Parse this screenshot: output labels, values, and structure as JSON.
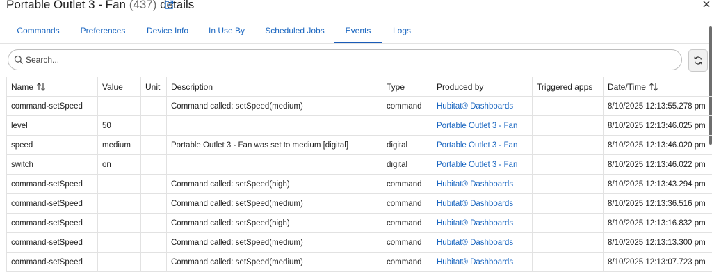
{
  "header": {
    "title": "Portable Outlet 3 - Fan",
    "device_count": "(437)",
    "title_suffix": "details"
  },
  "tabs": [
    {
      "label": "Commands"
    },
    {
      "label": "Preferences"
    },
    {
      "label": "Device Info"
    },
    {
      "label": "In Use By"
    },
    {
      "label": "Scheduled Jobs"
    },
    {
      "label": "Events",
      "active": true
    },
    {
      "label": "Logs"
    }
  ],
  "search": {
    "placeholder": "Search..."
  },
  "table": {
    "columns": [
      "Name",
      "Value",
      "Unit",
      "Description",
      "Type",
      "Produced by",
      "Triggered apps",
      "Date/Time"
    ],
    "rows": [
      [
        "command-setSpeed",
        "",
        "",
        "Command called: setSpeed(medium)",
        "command",
        "Hubitat® Dashboards",
        "",
        "8/10/2025 12:13:55.278 pm"
      ],
      [
        "level",
        "50",
        "",
        "",
        "",
        "Portable Outlet 3 - Fan",
        "",
        "8/10/2025 12:13:46.025 pm"
      ],
      [
        "speed",
        "medium",
        "",
        "Portable Outlet 3 - Fan was set to medium [digital]",
        "digital",
        "Portable Outlet 3 - Fan",
        "",
        "8/10/2025 12:13:46.020 pm"
      ],
      [
        "switch",
        "on",
        "",
        "",
        "digital",
        "Portable Outlet 3 - Fan",
        "",
        "8/10/2025 12:13:46.022 pm"
      ],
      [
        "command-setSpeed",
        "",
        "",
        "Command called: setSpeed(high)",
        "command",
        "Hubitat® Dashboards",
        "",
        "8/10/2025 12:13:43.294 pm"
      ],
      [
        "command-setSpeed",
        "",
        "",
        "Command called: setSpeed(medium)",
        "command",
        "Hubitat® Dashboards",
        "",
        "8/10/2025 12:13:36.516 pm"
      ],
      [
        "command-setSpeed",
        "",
        "",
        "Command called: setSpeed(high)",
        "command",
        "Hubitat® Dashboards",
        "",
        "8/10/2025 12:13:16.832 pm"
      ],
      [
        "command-setSpeed",
        "",
        "",
        "Command called: setSpeed(medium)",
        "command",
        "Hubitat® Dashboards",
        "",
        "8/10/2025 12:13:13.300 pm"
      ],
      [
        "command-setSpeed",
        "",
        "",
        "Command called: setSpeed(medium)",
        "command",
        "Hubitat® Dashboards",
        "",
        "8/10/2025 12:13:07.723 pm"
      ]
    ]
  },
  "colors": {
    "link": "#1a66c0",
    "active_tab_underline": "#1a5cb8",
    "border": "#e2e2e2"
  }
}
